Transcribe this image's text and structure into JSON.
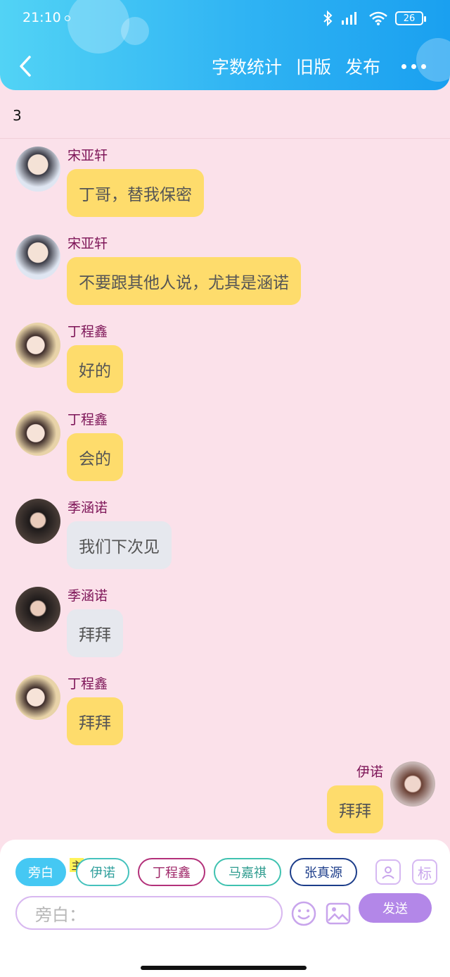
{
  "status_bar": {
    "time": "21:10",
    "battery": "26",
    "network": "HD"
  },
  "nav": {
    "actions": [
      "字数统计",
      "旧版",
      "发布"
    ]
  },
  "word_count": "3",
  "messages": [
    {
      "name": "宋亚轩",
      "text": "丁哥，替我保密",
      "avatar": "song"
    },
    {
      "name": "宋亚轩",
      "text": "不要跟其他人说，尤其是涵诺",
      "avatar": "song"
    },
    {
      "name": "丁程鑫",
      "text": "好的",
      "avatar": "ding"
    },
    {
      "name": "丁程鑫",
      "text": "会的",
      "avatar": "ding"
    },
    {
      "name": "季涵诺",
      "text": "我们下次见",
      "avatar": "ji"
    },
    {
      "name": "季涵诺",
      "text": "拜拜",
      "avatar": "ji"
    },
    {
      "name": "丁程鑫",
      "text": "拜拜",
      "avatar": "ding"
    },
    {
      "name": "伊诺",
      "text": "拜拜",
      "avatar": "yinuo"
    }
  ],
  "role_bar": {
    "chips": [
      "旁白",
      "伊诺",
      "丁程鑫",
      "马嘉祺",
      "张真源"
    ],
    "main_tag": "主",
    "tag_button": "标"
  },
  "composer": {
    "placeholder": "旁白：",
    "send_label": "发送"
  },
  "colors": {
    "header": "#2fb3f3",
    "background": "#fbe1ea",
    "yellow_bubble": "#fedc6c",
    "grey_bubble": "#e6e8ee",
    "send": "#b387e8",
    "name": "#7d1457"
  }
}
